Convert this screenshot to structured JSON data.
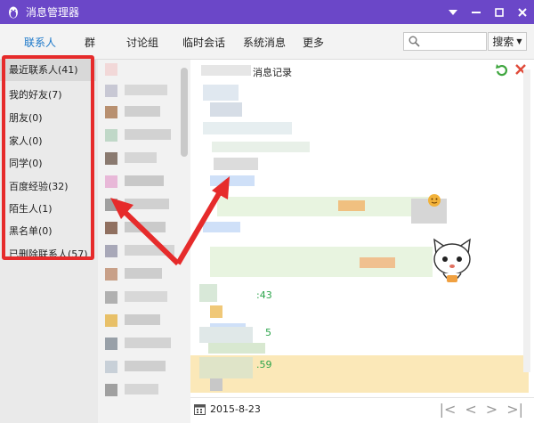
{
  "window": {
    "title": "消息管理器",
    "accent": "#6b47c8"
  },
  "tabs": [
    "联系人",
    "群",
    "讨论组",
    "临时会话",
    "系统消息",
    "更多"
  ],
  "search": {
    "placeholder": "",
    "button_label": "搜索"
  },
  "groups": [
    "最近联系人(41)",
    "我的好友(7)",
    "朋友(0)",
    "家人(0)",
    "同学(0)",
    "百度经验(32)",
    "陌生人(1)",
    "黑名单(0)",
    "已删除联系人(57)"
  ],
  "message": {
    "header": "消息记录",
    "times": [
      ":43",
      "5",
      ".59"
    ]
  },
  "footer": {
    "date": "2015-8-23"
  },
  "annotation": {
    "color": "#e62b2b"
  }
}
